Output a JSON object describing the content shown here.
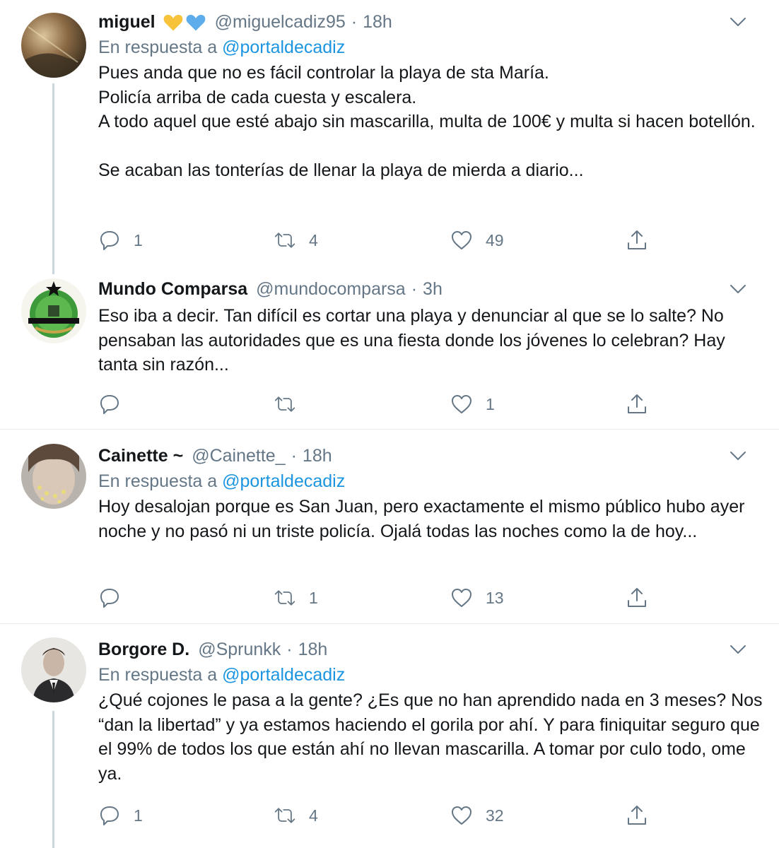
{
  "tweets": [
    {
      "name": "miguel",
      "handle": "@miguelcadiz95",
      "separator": "·",
      "time": "18h",
      "reply_prefix": "En respuesta a",
      "reply_to": "@portaldecadiz",
      "text": "Pues anda que no es fácil controlar la playa de sta María.\nPolicía arriba de cada cuesta y escalera.\nA todo aquel que esté abajo sin mascarilla, multa de 100€ y multa si hacen botellón.\n\nSe acaban las tonterías de llenar la playa de mierda a diario...",
      "replies": "1",
      "retweets": "4",
      "likes": "49",
      "name_emoji": [
        "yellow-heart",
        "blue-heart"
      ]
    },
    {
      "name": "Mundo Comparsa",
      "handle": "@mundocomparsa",
      "separator": "·",
      "time": "3h",
      "text": "Eso iba a decir. Tan difícil es cortar una playa y denunciar al que se lo salte? No pensaban las autoridades que es una fiesta donde los jóvenes lo celebran? Hay tanta sin razón...",
      "replies": "",
      "retweets": "",
      "likes": "1"
    },
    {
      "name": "Cainette ~",
      "handle": "@Cainette_",
      "separator": "·",
      "time": "18h",
      "reply_prefix": "En respuesta a",
      "reply_to": "@portaldecadiz",
      "text": "Hoy desalojan porque es San Juan, pero exactamente el mismo público hubo ayer noche y no pasó ni un triste policía. Ojalá todas las noches como la de hoy...",
      "replies": "",
      "retweets": "1",
      "likes": "13"
    },
    {
      "name": "Borgore D.",
      "handle": "@Sprunkk",
      "separator": "·",
      "time": "18h",
      "reply_prefix": "En respuesta a",
      "reply_to": "@portaldecadiz",
      "text": "¿Qué cojones le pasa a la gente? ¿Es que no han aprendido nada en 3 meses? Nos “dan la libertad” y ya estamos haciendo el gorila por ahí. Y para finiquitar seguro que el 99% de todos los que están ahí no llevan mascarilla. A tomar por culo todo, ome ya.",
      "replies": "1",
      "retweets": "4",
      "likes": "32"
    }
  ],
  "icons": {
    "reply": "reply-icon",
    "retweet": "retweet-icon",
    "like": "heart-icon",
    "share": "share-icon",
    "more": "chevron-down-icon"
  },
  "colors": {
    "text": "#14171a",
    "muted": "#657786",
    "link": "#1b95e0",
    "divider": "#e6ecf0",
    "heart_yellow": "#f7c33a",
    "heart_blue": "#5dadec"
  }
}
